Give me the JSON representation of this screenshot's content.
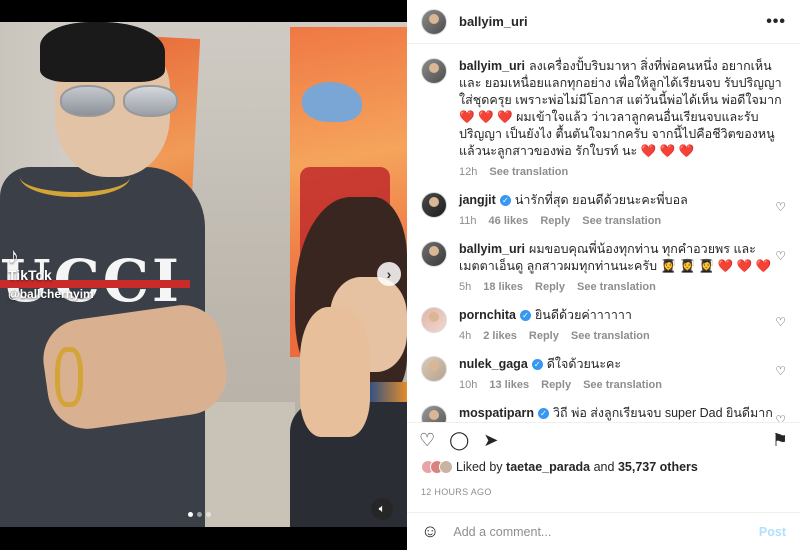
{
  "media": {
    "watermark_brand": "TikTok",
    "watermark_user": "@ballchernyim",
    "next_icon": "chevron-right-icon",
    "mute_icon": "speaker-icon",
    "carousel_count": 3,
    "carousel_active": 0,
    "shirt_text": "UCCI"
  },
  "header": {
    "username": "ballyim_uri",
    "more": "•••"
  },
  "caption": {
    "username": "ballyim_uri",
    "text": "ลงเครื่องปั้บริบมาหา สิ่งที่พ่อคนหนึ่ง อยากเห็น และ ยอมเหนื่อยแลกทุกอย่าง เพื่อให้ลูกได้เรียนจบ รับปริญญา ใส่ชุดครุย เพราะพ่อไม่มีโอกาส แต่วันนี้พ่อได้เห็น พ่อดีใจมาก ❤️ ❤️ ❤️ ผมเข้าใจแล้ว ว่าเวลาลูกคนอื่นเรียนจบและรับปริญญา เป็นยังไง ตื้นตันใจมากครับ จากนี้ไปคือชีวิตของหนูแล้วนะลูกสาวของพ่อ รักใบรท์ นะ ❤️ ❤️ ❤️",
    "time": "12h",
    "translation": "See translation"
  },
  "comments": [
    {
      "username": "jangjit",
      "verified": true,
      "text": "น่ารักที่สุด ยอนดีด้วยนะคะพี่บอล",
      "time": "11h",
      "likes": "46 likes",
      "reply": "Reply",
      "translation": "See translation"
    },
    {
      "username": "ballyim_uri",
      "verified": false,
      "text": "ผมขอบคุณพี่น้องทุกท่าน ทุกคำอวยพร และ เมตตาเอ็นดู ลูกสาวผมทุกท่านนะครับ 👩‍🎓 👩‍🎓 👩‍🎓 ❤️ ❤️ ❤️",
      "time": "5h",
      "likes": "18 likes",
      "reply": "Reply",
      "translation": "See translation"
    },
    {
      "username": "pornchita",
      "verified": true,
      "text": "ยินดีด้วยค่าาาาาา",
      "time": "4h",
      "likes": "2 likes",
      "reply": "Reply",
      "translation": "See translation"
    },
    {
      "username": "nulek_gaga",
      "verified": true,
      "text": "ดีใจด้วยนะคะ",
      "time": "10h",
      "likes": "13 likes",
      "reply": "Reply",
      "translation": "See translation"
    },
    {
      "username": "mospatiparn",
      "verified": true,
      "text": "วิถี พ่อ ส่งลูกเรียนจบ super Dad ยินดีมาก 🔥 🔥 ❤️ ❤️ 😍",
      "time": "",
      "likes": "",
      "reply": "",
      "translation": ""
    }
  ],
  "actions": {
    "like_icon": "heart-icon",
    "comment_icon": "comment-icon",
    "share_icon": "send-icon",
    "save_icon": "bookmark-icon"
  },
  "likes": {
    "prefix": "Liked by",
    "user": "taetae_parada",
    "joiner": "and",
    "others": "35,737 others"
  },
  "timestamp": "12 HOURS AGO",
  "add_comment": {
    "placeholder": "Add a comment...",
    "post": "Post",
    "emoji_icon": "smiley-icon"
  },
  "colors": {
    "verified": "#3897f0",
    "post_disabled": "#b2dffc",
    "muted_text": "#8e8e8e"
  }
}
